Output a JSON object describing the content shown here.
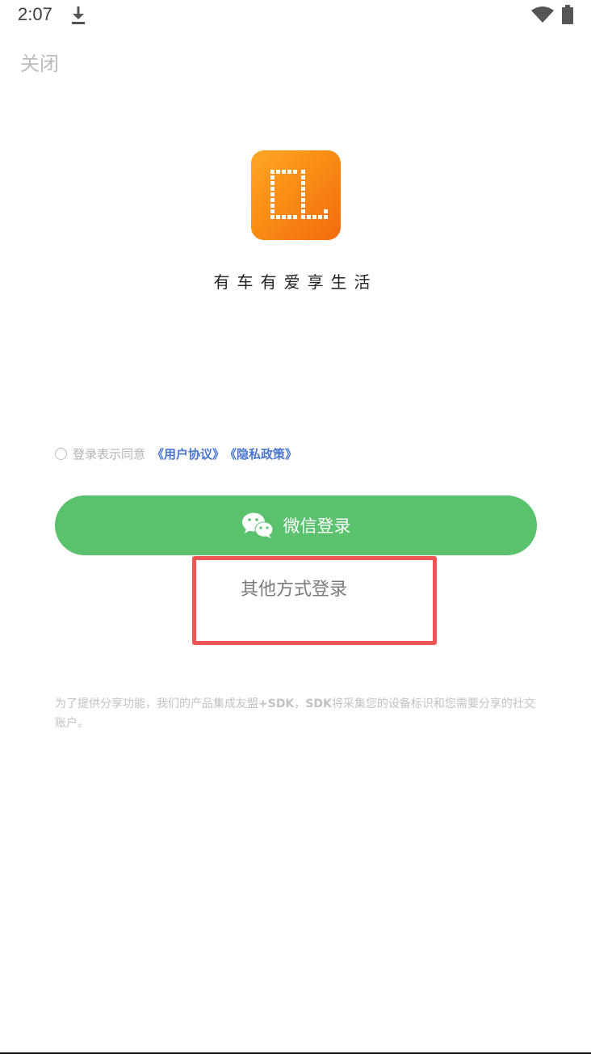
{
  "status_bar": {
    "time": "2:07",
    "icons": [
      "download-icon",
      "wifi-icon",
      "battery-icon"
    ]
  },
  "header": {
    "close_label": "关闭"
  },
  "brand": {
    "logo_icon": "app-logo-icon",
    "logo_gradient": [
      "#ffa726",
      "#f26b0f"
    ],
    "slogan": "有车有爱享生活"
  },
  "agreement": {
    "prefix": "登录表示同意",
    "user_agreement": "《用户协议》",
    "privacy_policy": "《隐私政策》",
    "checked": false,
    "link_color": "#4a76d0"
  },
  "wechat_login": {
    "label": "微信登录",
    "icon": "wechat-icon",
    "color": "#5ac16d"
  },
  "other_login": {
    "label": "其他方式登录",
    "highlight_color": "#f05454"
  },
  "disclaimer": {
    "text_1": "为了提供分享功能，我们的产品集成友盟",
    "bold_1": "+SDK",
    "text_2": "，",
    "bold_2": "SDK",
    "text_3": "将采集您的设备标识和您需要分享的社交账户。"
  }
}
